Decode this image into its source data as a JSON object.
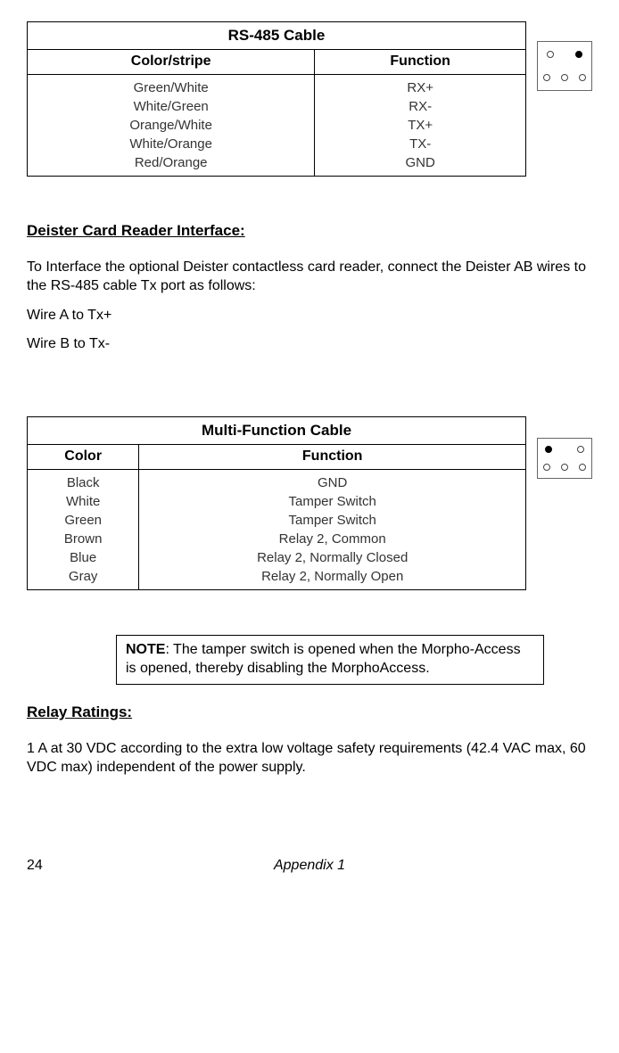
{
  "table1": {
    "title": "RS-485 Cable",
    "headers": [
      "Color/stripe",
      "Function"
    ],
    "rows": [
      [
        "Green/White",
        "RX+"
      ],
      [
        "White/Green",
        "RX-"
      ],
      [
        "Orange/White",
        "TX+"
      ],
      [
        "White/Orange",
        "TX-"
      ],
      [
        "Red/Orange",
        "GND"
      ]
    ]
  },
  "section1": {
    "heading": "Deister Card Reader Interface:",
    "para1": "To Interface the optional Deister contactless card reader, connect the Deister AB wires to the RS-485 cable Tx port as follows:",
    "para2": "Wire A to Tx+",
    "para3": "Wire B to Tx-"
  },
  "table2": {
    "title": "Multi-Function Cable",
    "headers": [
      "Color",
      "Function"
    ],
    "rows": [
      [
        "Black",
        "GND"
      ],
      [
        "White",
        "Tamper Switch"
      ],
      [
        "Green",
        "Tamper Switch"
      ],
      [
        "Brown",
        "Relay 2, Common"
      ],
      [
        "Blue",
        "Relay 2, Normally Closed"
      ],
      [
        "Gray",
        "Relay 2, Normally Open"
      ]
    ]
  },
  "note": {
    "label": "NOTE",
    "text": ": The tamper switch is opened when the Morpho-Access is opened, thereby disabling the MorphoAccess."
  },
  "section2": {
    "heading": "Relay Ratings:",
    "para1": "1 A at 30 VDC according to the extra low voltage safety requirements (42.4 VAC max, 60 VDC max) independent of the power supply."
  },
  "footer": {
    "page": "24",
    "appendix": "Appendix 1"
  }
}
